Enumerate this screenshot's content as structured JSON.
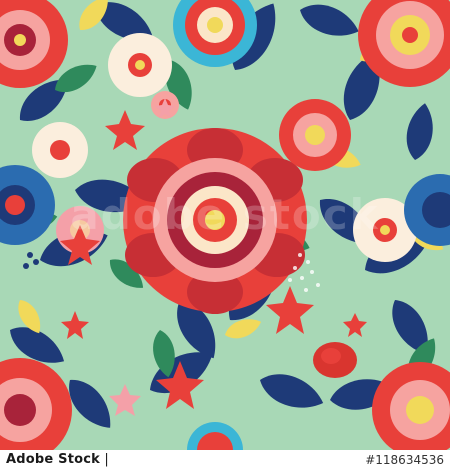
{
  "watermark": {
    "text": "adobe stock"
  },
  "footer": {
    "brand_name": "Adobe Stock",
    "separator": "|",
    "stock_id": "#118634536"
  },
  "colors": {
    "background": "#a8d8b6",
    "navy_leaf": "#1e3a78",
    "green_leaf": "#2f8a5c",
    "red_flower": "#e8403a",
    "pink": "#f4a0a8",
    "cream": "#fbeedd",
    "yellow": "#f1d95a",
    "blue_flower": "#2b6cb0"
  }
}
